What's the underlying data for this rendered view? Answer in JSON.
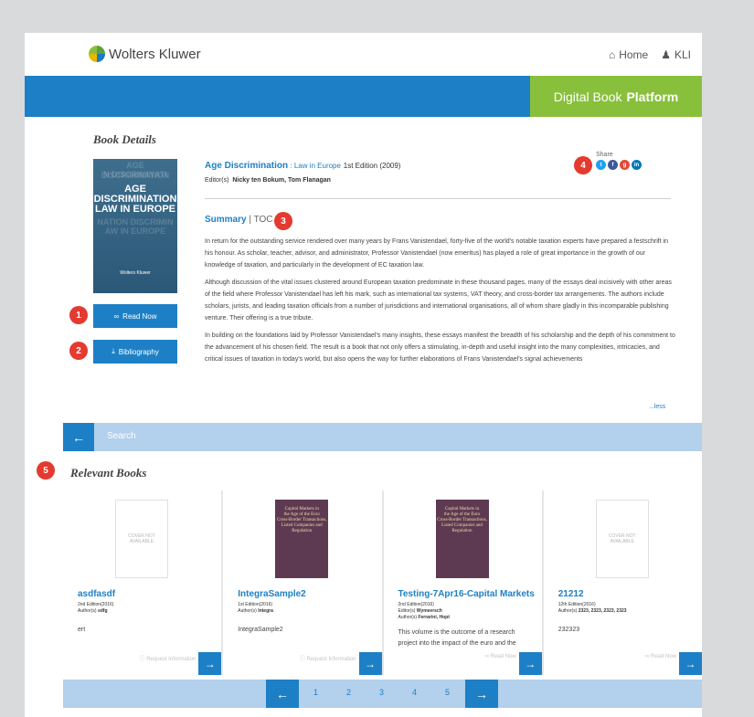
{
  "header": {
    "brand": "Wolters Kluwer",
    "nav": [
      {
        "label": "Home",
        "icon": "home-icon"
      },
      {
        "label": "KLI",
        "icon": "user-icon"
      }
    ],
    "platform_title_prefix": "Digital Book",
    "platform_title_bold": "Platform"
  },
  "colors": {
    "accent_blue": "#1d80c6",
    "accent_green": "#88c03c",
    "badge_red": "#e43a2f",
    "light_blue_bar": "#b3d0ec"
  },
  "book_details": {
    "section_title": "Book Details",
    "cover": {
      "watermark_top": [
        "AGE DISCRIMINATION",
        "N DISCRIMINATI"
      ],
      "title_lines": [
        "AGE",
        "DISCRIMINATION",
        "LAW IN EUROPE"
      ],
      "watermark_bottom": [
        "NATION DISCRIMIN",
        "AW IN EUROPE"
      ],
      "publisher": "Wolters Kluwer"
    },
    "title": "Age Discrimination",
    "separator": " : ",
    "series": "Law in Europe",
    "edition": "1st Edition (2009)",
    "editors_label": "Editor(s)",
    "editors": "Nicky ten Bokum, Tom Flanagan",
    "share_label": "Share",
    "share_icons": [
      "twitter-icon",
      "facebook-icon",
      "google-plus-icon",
      "linkedin-icon"
    ],
    "read_now_label": "Read Now",
    "bibliography_label": "Bibliography",
    "tabs": {
      "summary": "Summary",
      "separator": "|",
      "toc": "TOC"
    },
    "summary_paragraphs": [
      "In return for the outstanding service rendered over many years by Frans Vanistendael, forty-five of the world's notable taxation experts have prepared a festschrift in his honour. As scholar, teacher, advisor, and administrator, Professor Vanistendael (now emeritus) has played a role of great importance in the growth of our knowledge of taxation, and particularly in the development of EC taxation law.",
      "Although discussion of the vital issues clustered around European taxation predominate in these thousand pages, many of the essays deal incisively with other areas of the field where Professor Vanistendael has left his mark, such as international tax systems, VAT theory, and cross-border tax arrangements. The authors include scholars, jurists, and leading taxation officials from a number of jurisdictions and international organisations, all of whom share gladly in this incomparable publishing venture. Their offering is a true tribute.",
      "In building on the foundations laid by Professor Vanistendael's many insights, these essays manifest the breadth of his scholarship and the depth of his commitment to the advancement of his chosen field. The result is a book that not only offers a stimulating, in-depth and useful insight into the many complexities, intricacies, and critical issues of taxation in today's world, but also opens the way for further elaborations of Frans Vanistendael's signal achievements"
    ],
    "less_link": "...less"
  },
  "badges": [
    "1",
    "2",
    "3",
    "4",
    "5"
  ],
  "search": {
    "label": "Search"
  },
  "relevant": {
    "section_title": "Relevant Books",
    "cover_na": "COVER NOT AVAILABLE",
    "purple_cover": [
      "Capital Markets in",
      "the Age of the Euro",
      "Cross-Border Transactions,",
      "Listed Companies and Regulation"
    ],
    "books": [
      {
        "title": "asdfasdf",
        "edition": "2nd Edition(2016)",
        "people_label": "Author(s)",
        "people": "sdfg",
        "desc": "ert",
        "action": "Request Information"
      },
      {
        "title": "IntegraSample2",
        "edition": "1st Edition(2016)",
        "people_label": "Author(s)",
        "people": "Integra",
        "desc": "IntegraSample2",
        "action": "Request Information"
      },
      {
        "title": "Testing-7Apr16-Capital Markets",
        "edition": "2nd Edition(2016)",
        "people_label": "Editor(s)",
        "people": "Wymeersch",
        "people2_label": "Author(s)",
        "people2": "Ferrarini, Hopt",
        "desc": "This volume is the outcome of a research project into the impact of the euro and the",
        "action": "Read Now"
      },
      {
        "title": "21212",
        "edition": "12th Edition(2016)",
        "people_label": "Author(s)",
        "people": "2323, 2323, 2323, 2323",
        "desc": "232323",
        "action": "Read Now"
      }
    ]
  },
  "pagination": {
    "pages": [
      "1",
      "2",
      "3",
      "4",
      "5"
    ]
  }
}
